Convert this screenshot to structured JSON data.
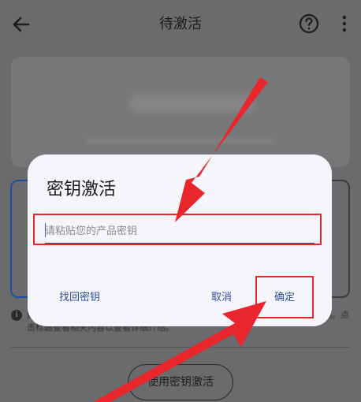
{
  "header": {
    "title": "待激活"
  },
  "notice": {
    "text": "如果您的设备使用了 Microsoft 帐户，可在此设备上使用该帐户与密钥激活产品。点击标题查看相关内容以查看详细介绍。"
  },
  "main": {
    "activate_with_key_label": "使用密钥激活"
  },
  "dialog": {
    "title": "密钥激活",
    "input_placeholder": "请粘贴您的产品密钥",
    "input_value": "",
    "find_key_label": "找回密钥",
    "cancel_label": "取消",
    "confirm_label": "确定"
  },
  "colors": {
    "accent": "#2f4f99",
    "annotation_red": "#e8262c",
    "dialog_bg": "#f4f6fb"
  },
  "icons": {
    "back": "arrow-left",
    "help": "question-circle",
    "more": "vertical-ellipsis",
    "info": "info-circle"
  }
}
